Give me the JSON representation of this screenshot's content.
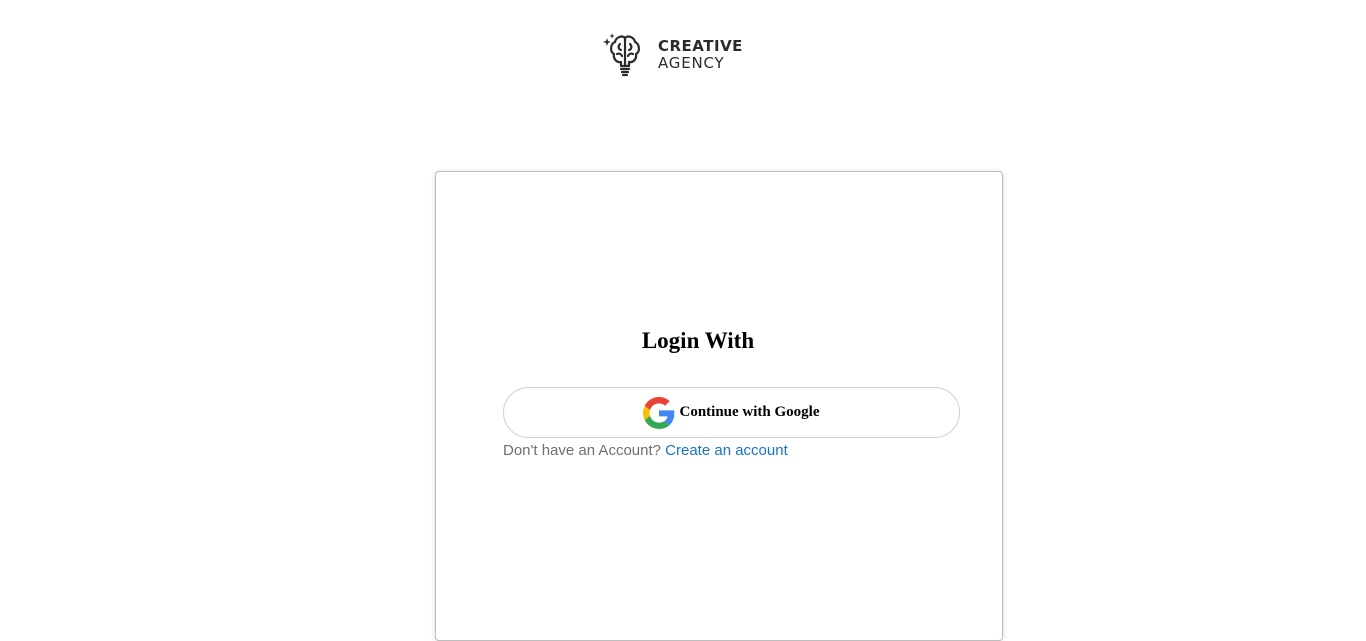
{
  "brand": {
    "line1": "CREATIVE",
    "line2": "AGENCY",
    "logo_icon": "brain-lightbulb-icon"
  },
  "login": {
    "title": "Login With",
    "google_button_label": "Continue with Google",
    "google_icon": "google-icon",
    "signup_prompt": "Don't have an Account?",
    "signup_link": "Create an account"
  },
  "colors": {
    "link": "#1a73c9",
    "prompt_text": "#6f6f6f",
    "card_border": "#bdbdbd",
    "button_border": "#cfcfcf"
  }
}
